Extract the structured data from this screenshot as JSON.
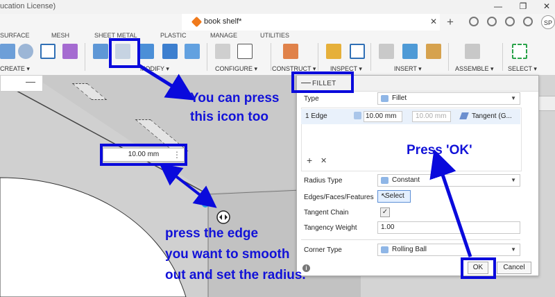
{
  "window": {
    "title": "ucation License)",
    "minimize": "—",
    "restore": "❐",
    "close": "✕"
  },
  "document_tab": {
    "label": "book shelf*",
    "close": "✕",
    "new_tab": "+"
  },
  "user": {
    "initials": "SP"
  },
  "ribbon": {
    "tabs": [
      "SURFACE",
      "MESH",
      "SHEET METAL",
      "PLASTIC",
      "MANAGE",
      "UTILITIES"
    ],
    "groups": [
      "CREATE ▾",
      "MODIFY ▾",
      "CONFIGURE ▾",
      "CONSTRUCT ▾",
      "INSPECT ▾",
      "INSERT ▾",
      "ASSEMBLE ▾",
      "SELECT ▾"
    ]
  },
  "browser_panel": {
    "collapse": "—"
  },
  "canvas": {
    "dimension_input": {
      "value": "10.00 mm",
      "menu": "⋮"
    }
  },
  "annotations": {
    "icon_note_line1": "You can press",
    "icon_note_line2": "this icon too",
    "ok_note": "Press 'OK'",
    "edge_note_line1": "press the edge",
    "edge_note_line2": "you want to smooth",
    "edge_note_line3": "out and set the radius."
  },
  "fillet_dialog": {
    "header_collapse": "—",
    "title": "FILLET",
    "type_label": "Type",
    "type_value": "Fillet",
    "edge_row": {
      "selection": "1 Edge",
      "radius": "10.00 mm",
      "radius_placeholder": "10.00 mm",
      "tangent": "Tangent (G..."
    },
    "add_button": "+",
    "remove_button": "✕",
    "radius_type_label": "Radius Type",
    "radius_type_value": "Constant",
    "edges_label": "Edges/Faces/Features",
    "select_button": "Select",
    "tangent_chain_label": "Tangent Chain",
    "tangent_chain_checked": true,
    "tangency_weight_label": "Tangency Weight",
    "tangency_weight_value": "1.00",
    "corner_type_label": "Corner Type",
    "corner_type_value": "Rolling Ball",
    "info_icon": "i",
    "ok_button": "OK",
    "cancel_button": "Cancel"
  },
  "colors": {
    "annotation": "#1212d8",
    "selection_highlight": "#e9f1fb"
  }
}
